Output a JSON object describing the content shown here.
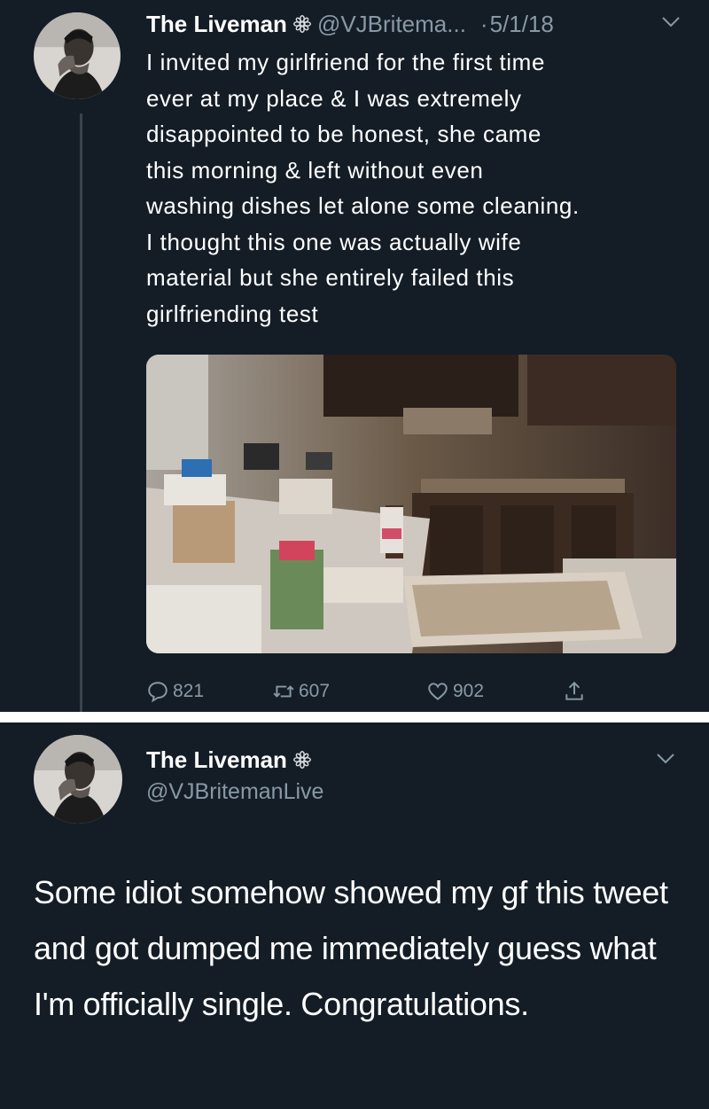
{
  "colors": {
    "background": "#141d26",
    "text": "#ffffff",
    "muted": "#8899a6",
    "separator": "#ffffff"
  },
  "tweet": {
    "display_name": "The Liveman",
    "badge_icon": "flower-badge-icon",
    "handle": "@VJBritema...",
    "dot": "·",
    "date": "5/1/18",
    "text": "I invited my girlfriend for the first time\never at my place & I was extremely\ndisappointed to be honest, she came\nthis morning & left without even\nwashing dishes let alone some cleaning.\nI thought this one was actually wife\nmaterial but she entirely failed this\ngirlfriending test",
    "image_icon": "messy-kitchen-photo",
    "actions": {
      "replies": "821",
      "retweets": "607",
      "likes": "902"
    }
  },
  "reply": {
    "display_name": "The Liveman",
    "badge_icon": "flower-badge-icon",
    "handle": "@VJBritemanLive",
    "text": "Some idiot somehow showed my gf this tweet and got dumped me immediately guess what I'm officially single. Congratulations."
  }
}
